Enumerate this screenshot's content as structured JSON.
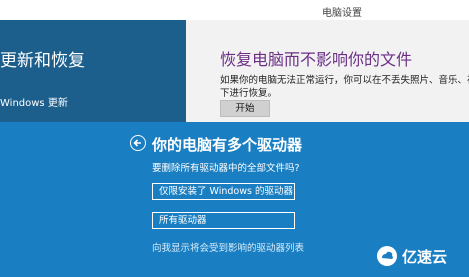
{
  "window": {
    "title": "电脑设置"
  },
  "left_panel": {
    "heading": "更新和恢复",
    "sub_item": "Windows 更新"
  },
  "right_panel": {
    "heading": "恢复电脑而不影响你的文件",
    "description_line1": "如果你的电脑无法正常运行，你可以在不丢失照片、音乐、视频和其他个人文件的情况",
    "description_line2": "下进行恢复。",
    "start_button": "开始"
  },
  "dialog": {
    "title": "你的电脑有多个驱动器",
    "question": "要删除所有驱动器中的全部文件吗?",
    "option_windows_only": "仅限安装了 Windows 的驱动器",
    "option_all_drives": "所有驱动器",
    "show_drives_link": "向我显示将会受到影响的驱动器列表"
  },
  "watermark": {
    "text": "亿速云"
  },
  "colors": {
    "dialog_bg": "#1a7ec2",
    "left_panel_bg": "#1c5f8c",
    "heading_purple": "#6b2f86",
    "right_panel_bg": "#f2f2f2"
  }
}
